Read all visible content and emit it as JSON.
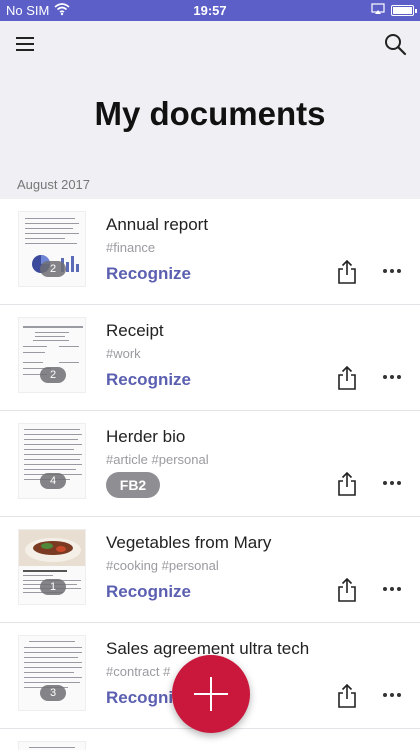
{
  "status_bar": {
    "carrier": "No SIM",
    "time": "19:57"
  },
  "header": {
    "title": "My documents"
  },
  "section": {
    "label": "August 2017"
  },
  "documents": [
    {
      "title": "Annual report",
      "tags": "#finance",
      "action": "Recognize",
      "pages": "2"
    },
    {
      "title": "Receipt",
      "tags": "#work",
      "action": "Recognize",
      "pages": "2"
    },
    {
      "title": "Herder bio",
      "tags": "#article  #personal",
      "action": "FB2",
      "pages": "4"
    },
    {
      "title": "Vegetables from Mary",
      "tags": "#cooking  #personal",
      "action": "Recognize",
      "pages": "1"
    },
    {
      "title": "Sales agreement ultra tech",
      "tags": "#contract  #",
      "action": "Recognize",
      "pages": "3"
    }
  ],
  "colors": {
    "status_bar": "#5b5fc7",
    "accent": "#5b5fb0",
    "fab": "#c9183b"
  }
}
